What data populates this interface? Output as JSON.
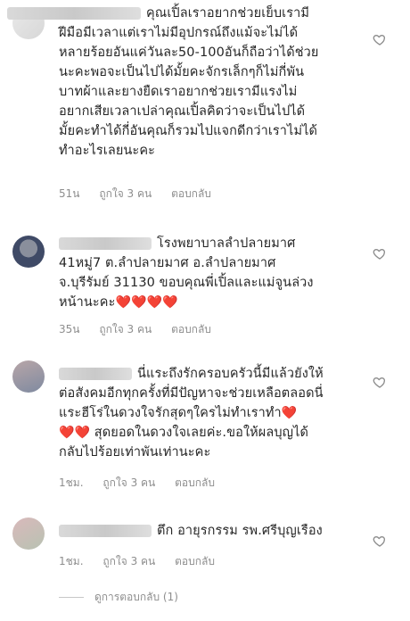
{
  "comments": [
    {
      "lines": [
        "คุณเปิ้ลเราอยากช่วยเย็บเรามี",
        "ฝีมือมีเวลาแต่เราไม่มีอุปกรณ์ถึงแม้จะไม่ได้",
        "หลายร้อยอันแค่วันละ50-100อันก็ถือว่าได้ช่วย",
        "นะคะพอจะเป็นไปได้มั้ยคะจักรเล็กๆก็ไม่กี่พัน",
        "บาทผ้าและยางยืดเราอยากช่วยเรามีแรงไม่",
        "อยากเสียเวลาเปล่าคุณเปิ้ลคิดว่าจะเป็นไปได้",
        "มั้ยคะทำได้กี่อันคุณก็รวมไปแจกดีกว่าเราไม่ได้",
        "ทำอะไรเลยนะคะ"
      ],
      "time": "51น",
      "likes": "ถูกใจ 3 คน",
      "reply": "ตอบกลับ"
    },
    {
      "lines": [
        "โรงพยาบาลลำปลายมาศ",
        "41หมู่7 ต.ลำปลายมาศ อ.ลำปลายมาศ",
        "จ.บุรีรัมย์ 31130  ขอบคุณพี่เปิ้ลและแม่จูนล่วง",
        "หน้านะคะ"
      ],
      "hearts": "❤️❤️❤️❤️",
      "time": "35น",
      "likes": "ถูกใจ 3 คน",
      "reply": "ตอบกลับ"
    },
    {
      "lines": [
        "นี่แระถึงรักครอบครัวนี้มีแล้วยังให้",
        "ต่อสังคมอีกทุกครั้งที่มีปัญหาจะช่วยเหลือตลอดนี่",
        "แระฮีโร่ในดวงใจรักสุดๆใครไม่ทำเราทำ",
        "สุดยอดในดวงใจเลยค่ะ.ขอให้ผลบุญได้",
        "กลับไปร้อยเท่าพันเท่านะคะ"
      ],
      "heart_a": "❤️",
      "heart_b": "❤️❤️",
      "time": "1ชม.",
      "likes": "ถูกใจ 3 คน",
      "reply": "ตอบกลับ"
    },
    {
      "lines": [
        "ตึก อายุรกรรม รพ.ศรีบุญเรือง"
      ],
      "time": "1ชม.",
      "likes": "ถูกใจ 3 คน",
      "reply": "ตอบกลับ"
    }
  ],
  "view_replies": "ดูการตอบกลับ (1)",
  "colors": {
    "text": "#262626",
    "meta": "#8e8e8e",
    "heart": "#e0245e"
  },
  "icons": {
    "like": "heart-outline-icon"
  }
}
